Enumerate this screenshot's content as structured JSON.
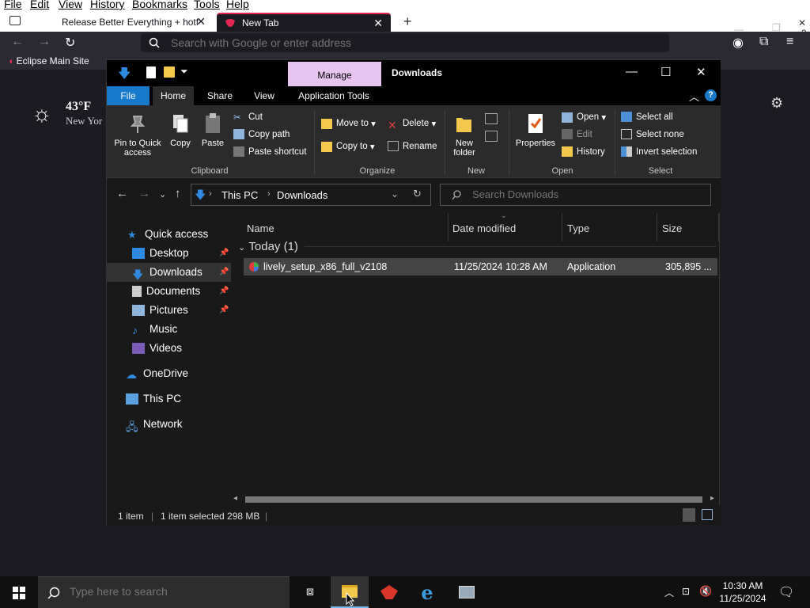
{
  "browser": {
    "menu": [
      "File",
      "Edit",
      "View",
      "History",
      "Bookmarks",
      "Tools",
      "Help"
    ],
    "tabs": [
      {
        "title": "Release Better Everything + hotf",
        "active": false
      },
      {
        "title": "New Tab",
        "active": true
      }
    ],
    "tab_count_badge": "2",
    "url_placeholder": "Search with Google or enter address",
    "bookmarks": [
      {
        "label": "Eclipse Main Site"
      }
    ],
    "weather": {
      "temp": "43°F",
      "location": "New Yor"
    }
  },
  "explorer": {
    "title": "Downloads",
    "context_tab": "Manage",
    "ribbon_tabs": [
      "File",
      "Home",
      "Share",
      "View",
      "Application Tools"
    ],
    "clipboard": {
      "pin": "Pin to Quick access",
      "copy": "Copy",
      "paste": "Paste",
      "cut": "Cut",
      "copy_path": "Copy path",
      "paste_shortcut": "Paste shortcut",
      "group": "Clipboard"
    },
    "organize": {
      "move_to": "Move to",
      "copy_to": "Copy to",
      "delete": "Delete",
      "rename": "Rename",
      "group": "Organize"
    },
    "new": {
      "new_folder": "New folder",
      "group": "New"
    },
    "open": {
      "properties": "Properties",
      "open": "Open",
      "edit": "Edit",
      "history": "History",
      "group": "Open"
    },
    "select": {
      "select_all": "Select all",
      "select_none": "Select none",
      "invert": "Invert selection",
      "group": "Select"
    },
    "breadcrumb": [
      "This PC",
      "Downloads"
    ],
    "search_placeholder": "Search Downloads",
    "nav": {
      "quick_access": "Quick access",
      "desktop": "Desktop",
      "downloads": "Downloads",
      "documents": "Documents",
      "pictures": "Pictures",
      "music": "Music",
      "videos": "Videos",
      "onedrive": "OneDrive",
      "this_pc": "This PC",
      "network": "Network"
    },
    "columns": {
      "name": "Name",
      "date": "Date modified",
      "type": "Type",
      "size": "Size"
    },
    "group_header": "Today (1)",
    "files": [
      {
        "name": "lively_setup_x86_full_v2108",
        "date": "11/25/2024 10:28 AM",
        "type": "Application",
        "size": "305,895 ..."
      }
    ],
    "status": {
      "count": "1 item",
      "selected": "1 item selected  298 MB"
    }
  },
  "taskbar": {
    "search_placeholder": "Type here to search",
    "time": "10:30 AM",
    "date": "11/25/2024"
  }
}
